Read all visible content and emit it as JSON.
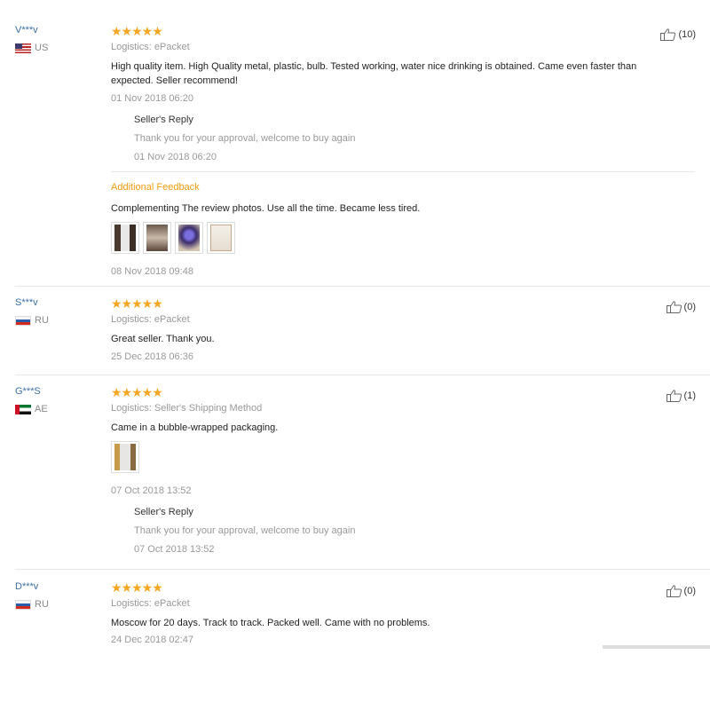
{
  "reviews": [
    {
      "user": "V***v",
      "country": "US",
      "stars": "★★★★★",
      "logistics": "Logistics: ePacket",
      "text_line1": "High quality item. High Quality metal, plastic, bulb. Tested working, water nice drinking is obtained. Came even faster than",
      "text_line2": "expected. Seller recommend!",
      "date": "01 Nov 2018 06:20",
      "helpful": "(10)",
      "reply": {
        "label": "Seller's Reply",
        "text": "Thank you for your approval, welcome to buy again",
        "date": "01 Nov 2018 06:20"
      },
      "additional": {
        "label": "Additional Feedback",
        "text": "Complementing The review photos. Use all the time. Became less tired.",
        "date": "08 Nov 2018 09:48"
      }
    },
    {
      "user": "S***v",
      "country": "RU",
      "stars": "★★★★★",
      "logistics": "Logistics: ePacket",
      "text": "Great seller. Thank you.",
      "date": "25 Dec 2018 06:36",
      "helpful": "(0)"
    },
    {
      "user": "G***S",
      "country": "AE",
      "stars": "★★★★★",
      "logistics": "Logistics: Seller's Shipping Method",
      "text": "Came in a bubble-wrapped packaging.",
      "date": "07 Oct 2018 13:52",
      "helpful": "(1)",
      "reply": {
        "label": "Seller's Reply",
        "text": "Thank you for your approval, welcome to buy again",
        "date": "07 Oct 2018 13:52"
      }
    },
    {
      "user": "D***v",
      "country": "RU",
      "stars": "★★★★★",
      "logistics": "Logistics: ePacket",
      "text": "Moscow for 20 days. Track to track. Packed well. Came with no problems.",
      "date": "24 Dec 2018 02:47",
      "helpful": "(0)"
    }
  ]
}
